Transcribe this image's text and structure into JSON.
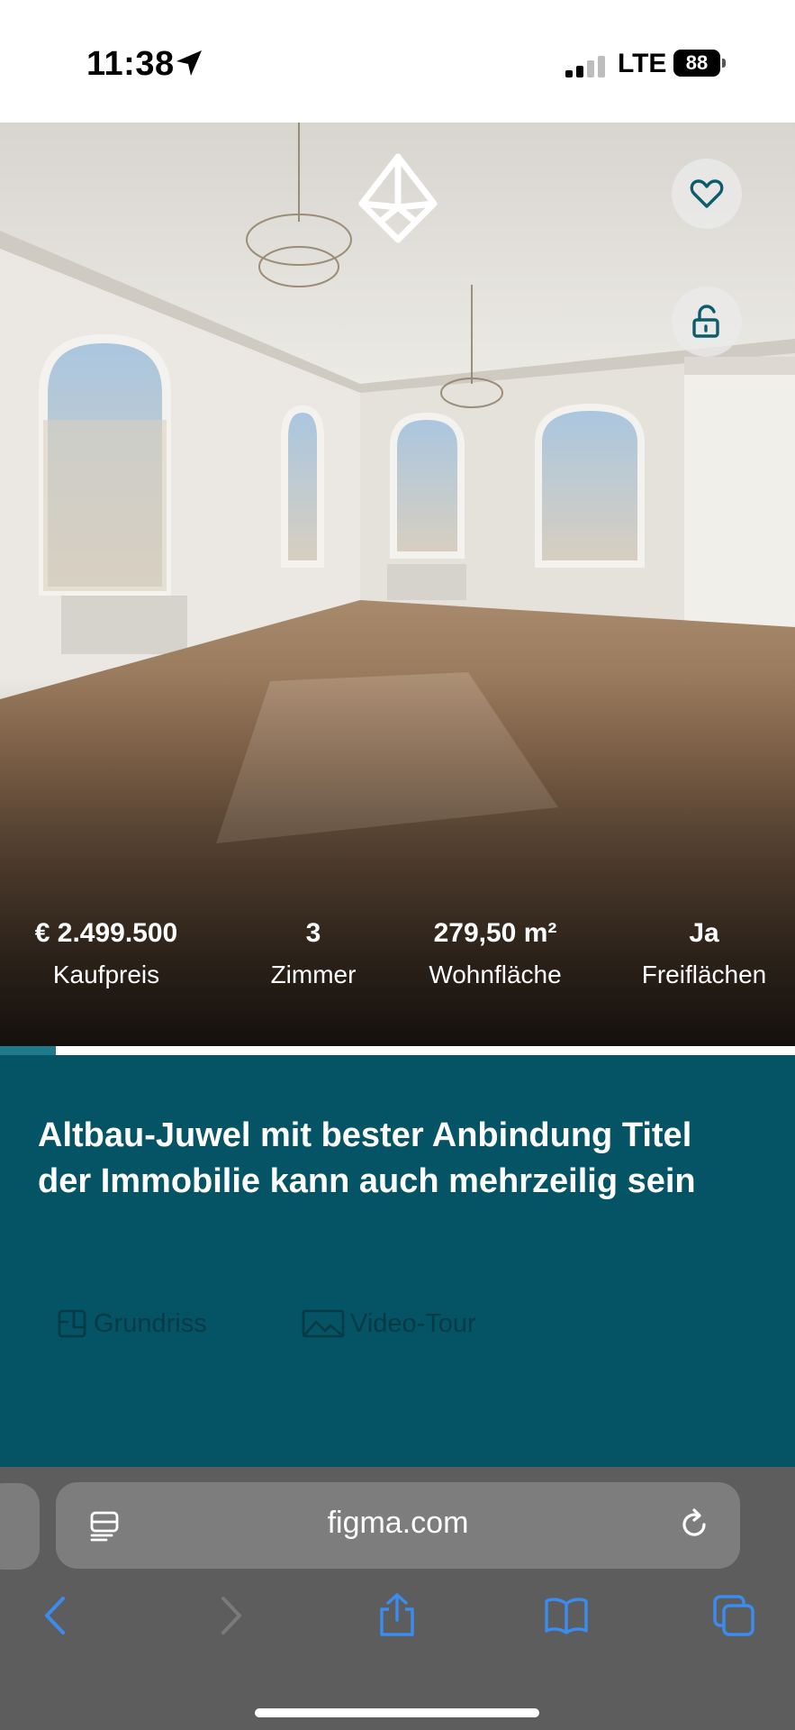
{
  "status_bar": {
    "time": "11:38",
    "carrier": "LTE",
    "battery": "88"
  },
  "hero": {
    "stats": [
      {
        "value": "€ 2.499.500",
        "label": "Kaufpreis"
      },
      {
        "value": "3",
        "label": "Zimmer"
      },
      {
        "value": "279,50 m²",
        "label": "Wohnfläche"
      },
      {
        "value": "Ja",
        "label": "Freiflächen"
      }
    ],
    "gallery_progress": 0.07
  },
  "listing": {
    "title": "Altbau-Juwel mit bester Anbindung Titel der Immobilie kann auch mehrzeilig sein",
    "links": {
      "floorplan": "Grundriss",
      "video": "Video-Tour"
    }
  },
  "browser": {
    "url": "figma.com"
  },
  "colors": {
    "accent_teal": "#045465",
    "progress": "#1f7a8c",
    "browser_blue": "#3b8cf0"
  }
}
